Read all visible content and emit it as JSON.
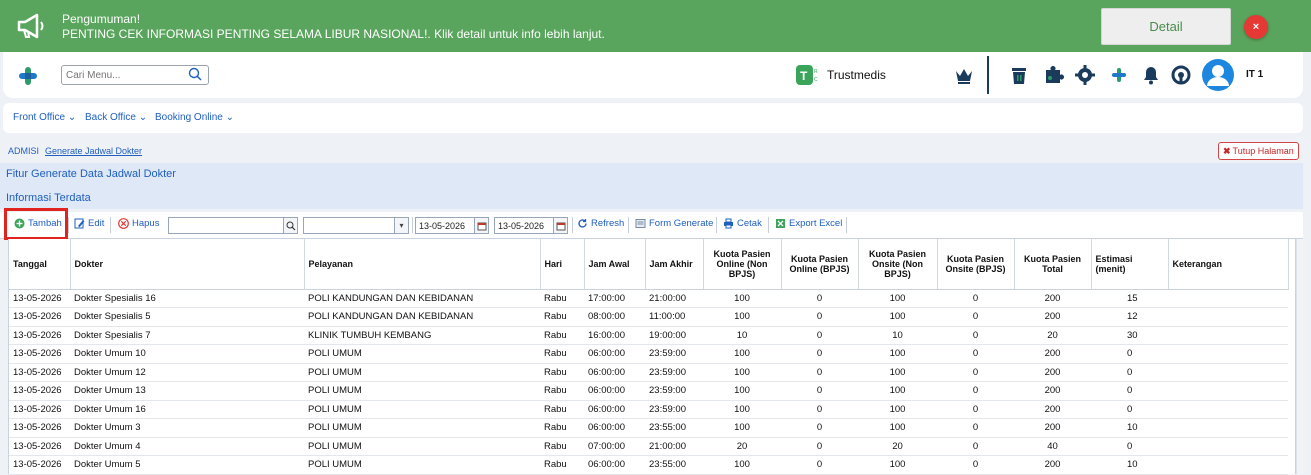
{
  "announcement": {
    "title": "Pengumuman!",
    "message": "PENTING CEK INFORMASI PENTING SELAMA LIBUR NASIONAL!. Klik detail untuk info lebih lanjut.",
    "detail_label": "Detail",
    "close_label": "×"
  },
  "header": {
    "search_placeholder": "Cari Menu...",
    "brand_name": "Trustmedis",
    "user_name": "IT 1",
    "icons": [
      "crown-icon",
      "trash-icon",
      "puzzle-icon",
      "gear-icon",
      "plus-cross-icon",
      "bell-icon",
      "headset-icon",
      "user-avatar-icon"
    ]
  },
  "nav": {
    "items": [
      "Front Office",
      "Back Office",
      "Booking Online"
    ]
  },
  "breadcrumb": {
    "root": "ADMISI",
    "current": "Generate Jadwal Dokter",
    "close_page": "Tutup Halaman"
  },
  "panel": {
    "title": "Fitur Generate Data Jadwal Dokter",
    "subtitle": "Informasi Terdata"
  },
  "toolbar": {
    "add": "Tambah",
    "edit": "Edit",
    "delete": "Hapus",
    "search_value": "",
    "select_value": "",
    "date_from": "13-05-2026",
    "date_to": "13-05-2026",
    "refresh": "Refresh",
    "form_generate": "Form Generate",
    "print": "Cetak",
    "export": "Export Excel"
  },
  "table": {
    "headers": [
      "Tanggal",
      "Dokter",
      "Pelayanan",
      "Hari",
      "Jam Awal",
      "Jam Akhir",
      "Kuota Pasien Online (Non BPJS)",
      "Kuota Pasien Online (BPJS)",
      "Kuota Pasien Onsite (Non BPJS)",
      "Kuota Pasien Onsite (BPJS)",
      "Kuota Pasien Total",
      "Estimasi (menit)",
      "Keterangan"
    ],
    "rows": [
      [
        "13-05-2026",
        "Dokter Spesialis 16",
        "POLI KANDUNGAN DAN KEBIDANAN",
        "Rabu",
        "17:00:00",
        "21:00:00",
        "100",
        "0",
        "100",
        "0",
        "200",
        "15",
        ""
      ],
      [
        "13-05-2026",
        "Dokter Spesialis 5",
        "POLI KANDUNGAN DAN KEBIDANAN",
        "Rabu",
        "08:00:00",
        "11:00:00",
        "100",
        "0",
        "100",
        "0",
        "200",
        "12",
        ""
      ],
      [
        "13-05-2026",
        "Dokter Spesialis 7",
        "KLINIK TUMBUH KEMBANG",
        "Rabu",
        "16:00:00",
        "19:00:00",
        "10",
        "0",
        "10",
        "0",
        "20",
        "30",
        ""
      ],
      [
        "13-05-2026",
        "Dokter Umum 10",
        "POLI UMUM",
        "Rabu",
        "06:00:00",
        "23:59:00",
        "100",
        "0",
        "100",
        "0",
        "200",
        "0",
        ""
      ],
      [
        "13-05-2026",
        "Dokter Umum 12",
        "POLI UMUM",
        "Rabu",
        "06:00:00",
        "23:59:00",
        "100",
        "0",
        "100",
        "0",
        "200",
        "0",
        ""
      ],
      [
        "13-05-2026",
        "Dokter Umum 13",
        "POLI UMUM",
        "Rabu",
        "06:00:00",
        "23:59:00",
        "100",
        "0",
        "100",
        "0",
        "200",
        "0",
        ""
      ],
      [
        "13-05-2026",
        "Dokter Umum 16",
        "POLI UMUM",
        "Rabu",
        "06:00:00",
        "23:59:00",
        "100",
        "0",
        "100",
        "0",
        "200",
        "0",
        ""
      ],
      [
        "13-05-2026",
        "Dokter Umum 3",
        "POLI UMUM",
        "Rabu",
        "06:00:00",
        "23:55:00",
        "100",
        "0",
        "100",
        "0",
        "200",
        "10",
        ""
      ],
      [
        "13-05-2026",
        "Dokter Umum 4",
        "POLI UMUM",
        "Rabu",
        "07:00:00",
        "21:00:00",
        "20",
        "0",
        "20",
        "0",
        "40",
        "0",
        ""
      ],
      [
        "13-05-2026",
        "Dokter Umum 5",
        "POLI UMUM",
        "Rabu",
        "06:00:00",
        "23:55:00",
        "100",
        "0",
        "100",
        "0",
        "200",
        "10",
        ""
      ]
    ]
  },
  "colors": {
    "announcement_bg": "#5aa55d",
    "link_blue": "#1f5fbf",
    "highlight_red": "#e0241d",
    "avatar_blue": "#1d87e0"
  }
}
